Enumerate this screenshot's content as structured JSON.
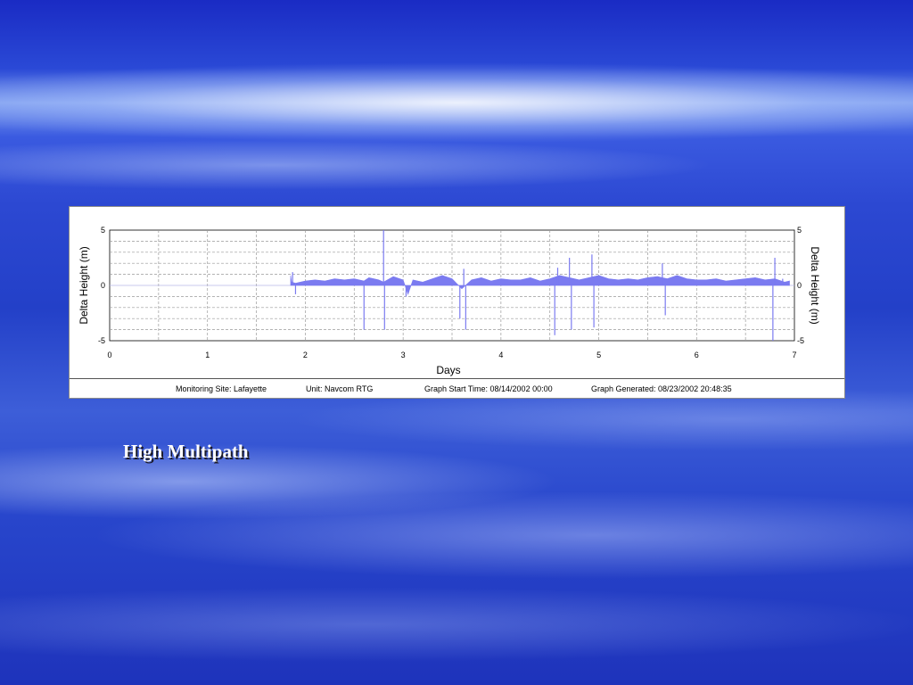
{
  "slide": {
    "title": "High Multipath"
  },
  "footer": {
    "site": "Monitoring Site: Lafayette",
    "unit": "Unit: Navcom RTG",
    "start": "Graph Start Time: 08/14/2002 00:00",
    "generated": "Graph Generated: 08/23/2002 20:48:35"
  },
  "chart_data": {
    "type": "area",
    "xlabel": "Days",
    "ylabel": "Delta Height (m)",
    "ylabel_right": "Delta Height (m)",
    "xlim": [
      0,
      7
    ],
    "ylim": [
      -5,
      5
    ],
    "xticks": [
      "0",
      "1",
      "2",
      "3",
      "4",
      "5",
      "6",
      "7"
    ],
    "yticks": [
      "5",
      "0",
      "-5"
    ],
    "grid": true,
    "color": "#7b7bf0",
    "series": [
      {
        "x": [
          1.85,
          1.86,
          1.9,
          2.0,
          2.1,
          2.2,
          2.3,
          2.4,
          2.5,
          2.6,
          2.65,
          2.7,
          2.75,
          2.8,
          2.9,
          3.0,
          3.05,
          3.1,
          3.2,
          3.3,
          3.4,
          3.5,
          3.6,
          3.7,
          3.8,
          3.9,
          4.0,
          4.1,
          4.2,
          4.3,
          4.4,
          4.5,
          4.6,
          4.7,
          4.8,
          4.9,
          5.0,
          5.1,
          5.2,
          5.3,
          5.4,
          5.5,
          5.6,
          5.7,
          5.8,
          5.9,
          6.0,
          6.1,
          6.2,
          6.3,
          6.4,
          6.5,
          6.6,
          6.7,
          6.8,
          6.9,
          6.95
        ],
        "y": [
          0.9,
          0.3,
          0.2,
          0.4,
          0.5,
          0.4,
          0.6,
          0.5,
          0.6,
          0.4,
          0.7,
          0.6,
          0.5,
          0.3,
          0.8,
          0.5,
          -0.8,
          0.5,
          0.3,
          0.6,
          0.9,
          0.6,
          -0.3,
          0.5,
          0.7,
          0.4,
          0.6,
          0.5,
          0.5,
          0.7,
          0.4,
          0.6,
          0.9,
          0.7,
          0.5,
          0.7,
          0.9,
          0.6,
          0.5,
          0.6,
          0.5,
          0.7,
          0.8,
          0.6,
          0.9,
          0.6,
          0.5,
          0.5,
          0.6,
          0.4,
          0.5,
          0.6,
          0.7,
          0.5,
          0.6,
          0.3,
          0.4
        ]
      }
    ],
    "spikes": [
      {
        "x": 1.87,
        "y": 1.2
      },
      {
        "x": 1.9,
        "y": -0.8
      },
      {
        "x": 2.6,
        "y": -4.0
      },
      {
        "x": 2.8,
        "y": 5.0
      },
      {
        "x": 2.81,
        "y": -4.0
      },
      {
        "x": 3.03,
        "y": -1.0
      },
      {
        "x": 3.58,
        "y": -3.0
      },
      {
        "x": 3.62,
        "y": 1.5
      },
      {
        "x": 3.64,
        "y": -4.0
      },
      {
        "x": 4.55,
        "y": -4.5
      },
      {
        "x": 4.58,
        "y": 1.6
      },
      {
        "x": 4.7,
        "y": 2.5
      },
      {
        "x": 4.72,
        "y": -4.0
      },
      {
        "x": 4.93,
        "y": 2.8
      },
      {
        "x": 4.95,
        "y": -3.8
      },
      {
        "x": 5.65,
        "y": 2.0
      },
      {
        "x": 5.68,
        "y": -2.7
      },
      {
        "x": 6.78,
        "y": -5.0
      },
      {
        "x": 6.8,
        "y": 2.5
      },
      {
        "x": 6.88,
        "y": 0.6
      }
    ]
  }
}
